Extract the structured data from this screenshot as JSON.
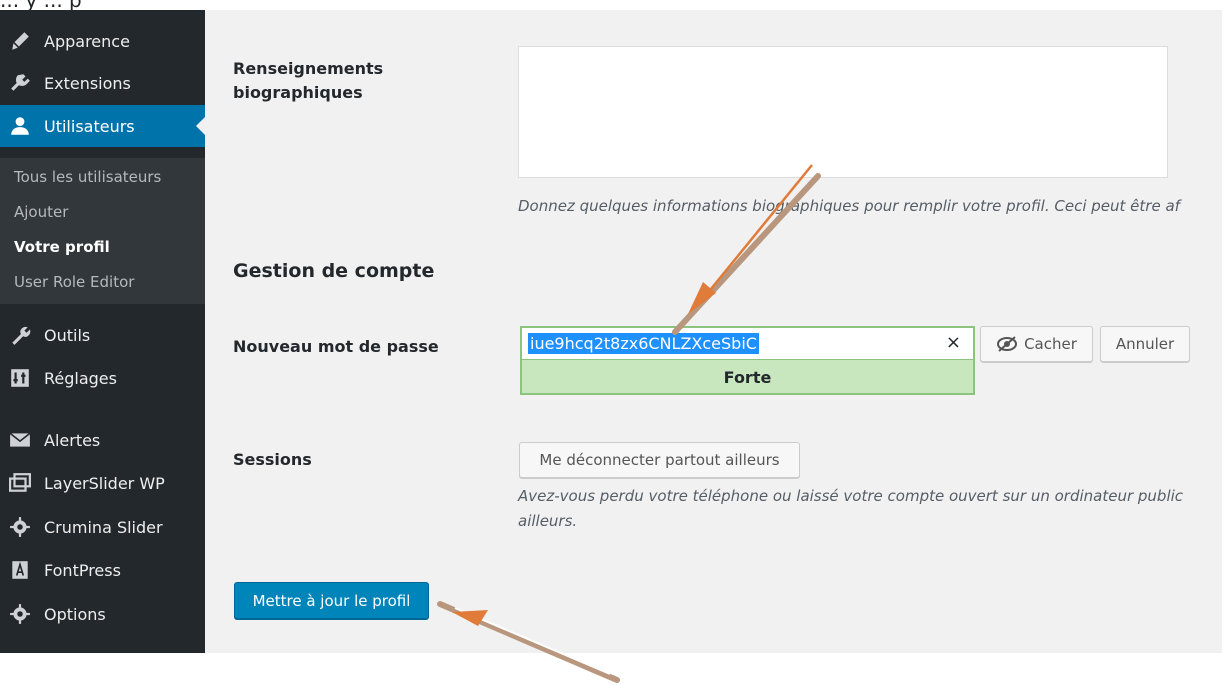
{
  "top_caption": "... y ... p",
  "sidebar": {
    "items": [
      {
        "label": "Apparence",
        "icon": "brush-icon"
      },
      {
        "label": "Extensions",
        "icon": "plugin-icon"
      },
      {
        "label": "Utilisateurs",
        "icon": "user-icon",
        "active": true
      },
      {
        "label": "Outils",
        "icon": "wrench-icon"
      },
      {
        "label": "Réglages",
        "icon": "settings-sliders-icon"
      },
      {
        "label": "Alertes",
        "icon": "envelope-icon"
      },
      {
        "label": "LayerSlider WP",
        "icon": "layers-icon"
      },
      {
        "label": "Crumina Slider",
        "icon": "gear-icon"
      },
      {
        "label": "FontPress",
        "icon": "font-icon"
      },
      {
        "label": "Options",
        "icon": "gear-icon"
      }
    ],
    "submenu": [
      {
        "label": "Tous les utilisateurs"
      },
      {
        "label": "Ajouter"
      },
      {
        "label": "Votre profil",
        "current": true
      },
      {
        "label": "User Role Editor"
      }
    ]
  },
  "form": {
    "bio_label_line1": "Renseignements",
    "bio_label_line2": "biographiques",
    "bio_value": "",
    "bio_description": "Donnez quelques informations biographiques pour remplir votre profil. Ceci peut être af",
    "section_title": "Gestion de compte",
    "password_label": "Nouveau mot de passe",
    "password_value": "iue9hcq2t8zx6CNLZXceSbiC",
    "password_clear": "×",
    "password_strength": "Forte",
    "hide_button": "Cacher",
    "cancel_button": "Annuler",
    "sessions_label": "Sessions",
    "logout_button": "Me déconnecter partout ailleurs",
    "sessions_description_line1": "Avez-vous perdu votre téléphone ou laissé votre compte ouvert sur un ordinateur public",
    "sessions_description_line2": "ailleurs.",
    "submit_button": "Mettre à jour le profil"
  },
  "colors": {
    "sidebar_bg": "#23282d",
    "active_item": "#0073aa",
    "primary_button": "#0085ba",
    "strength_strong": "#c9e7bf",
    "annotation_arrow": "#e07b39"
  }
}
